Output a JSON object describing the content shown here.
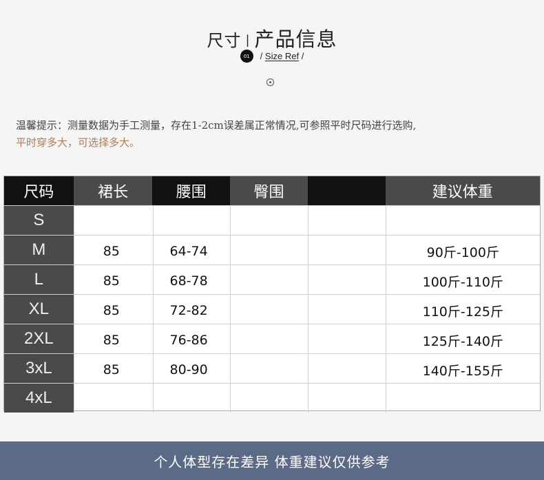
{
  "header": {
    "title_a": "尺寸",
    "title_sep": "|",
    "title_b": "产品信息",
    "badge": "01",
    "ref_prefix": "/",
    "ref_label": "Size Ref",
    "ref_suffix": "/"
  },
  "tip": {
    "line1": "温馨提示：测量数据为手工测量，存在1-2cm误差属正常情况,可参照平时尺码进行选购,",
    "line2": "平时穿多大，可选择多大。"
  },
  "table": {
    "headers": [
      "尺码",
      "裙长",
      "腰围",
      "臀围",
      "",
      "建议体重"
    ],
    "rows": [
      {
        "size": "S",
        "length": "",
        "waist": "",
        "hip": "",
        "extra": "",
        "weight": ""
      },
      {
        "size": "M",
        "length": "85",
        "waist": "64-74",
        "hip": "",
        "extra": "",
        "weight": "90斤-100斤"
      },
      {
        "size": "L",
        "length": "85",
        "waist": "68-78",
        "hip": "",
        "extra": "",
        "weight": "100斤-110斤"
      },
      {
        "size": "XL",
        "length": "85",
        "waist": "72-82",
        "hip": "",
        "extra": "",
        "weight": "110斤-125斤"
      },
      {
        "size": "2XL",
        "length": "85",
        "waist": "76-86",
        "hip": "",
        "extra": "",
        "weight": "125斤-140斤"
      },
      {
        "size": "3xL",
        "length": "85",
        "waist": "80-90",
        "hip": "",
        "extra": "",
        "weight": "140斤-155斤"
      },
      {
        "size": "4xL",
        "length": "",
        "waist": "",
        "hip": "",
        "extra": "",
        "weight": ""
      }
    ]
  },
  "footer": {
    "text": "个人体型存在差异  体重建议仅供参考"
  },
  "colors": {
    "header_dark": "#111111",
    "header_gray": "#4a4a4a",
    "tip_highlight": "#b07c58",
    "footer_bg": "#5b6a86"
  }
}
